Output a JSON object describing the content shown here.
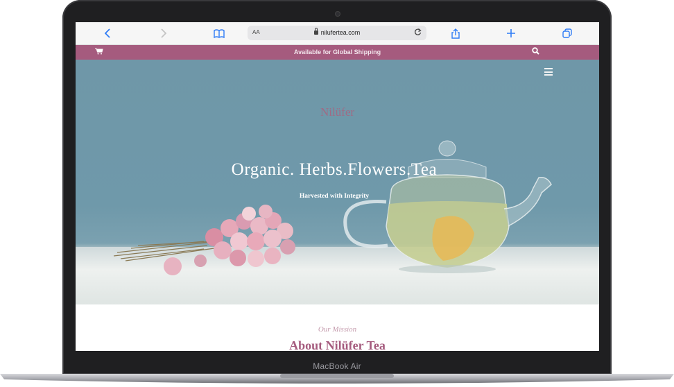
{
  "device": {
    "label": "MacBook Air"
  },
  "browser": {
    "text_size_label": "AA",
    "url": "nilufertea.com",
    "icons": [
      "back-chevron-icon",
      "forward-chevron-icon",
      "bookmarks-icon",
      "reload-icon",
      "share-icon",
      "new-tab-icon",
      "tabs-icon"
    ]
  },
  "site": {
    "promo_text": "Available for Global Shipping",
    "brand": "Nilüfer",
    "hero_title": "Organic. Herbs.Flowers.Tea",
    "hero_subtitle": "Harvested with Integrity",
    "mission_label": "Our Mission",
    "about_heading": "About Nilüfer Tea",
    "colors": {
      "accent": "#a55b7e",
      "hero_blue": "#6f97a8"
    }
  }
}
